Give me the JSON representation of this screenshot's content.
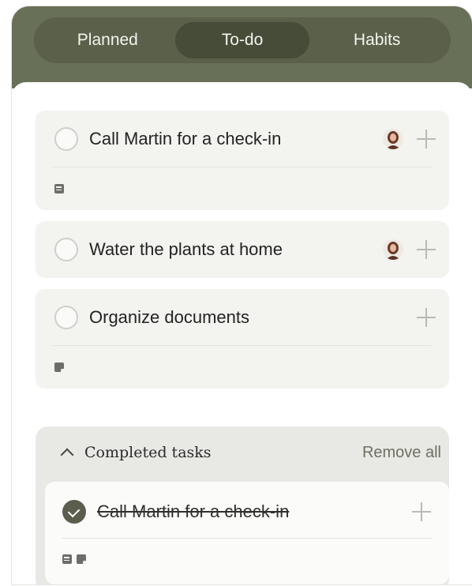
{
  "tabs": [
    {
      "label": "Planned",
      "active": false
    },
    {
      "label": "To-do",
      "active": true
    },
    {
      "label": "Habits",
      "active": false
    }
  ],
  "tasks": [
    {
      "title": "Call Martin for a check-in",
      "has_avatar": true,
      "note_icon": "note-lines-icon"
    },
    {
      "title": "Water the plants at home",
      "has_avatar": true
    },
    {
      "title": "Organize documents",
      "has_avatar": false,
      "note_icon": "note-icon"
    }
  ],
  "completed": {
    "heading": "Completed tasks",
    "remove_all_label": "Remove all",
    "items": [
      {
        "title": "Call Martin for a check-in",
        "done": true,
        "note_icons": [
          "note-lines-icon",
          "note-icon"
        ]
      }
    ]
  },
  "colors": {
    "header": "#697058",
    "tab_track": "#5a6049",
    "tab_active": "#474c38",
    "card": "#f3f3f0",
    "completed_bg": "#e8e8e5",
    "check": "#5b5e4c",
    "remove_all_text": "#6d705f"
  }
}
